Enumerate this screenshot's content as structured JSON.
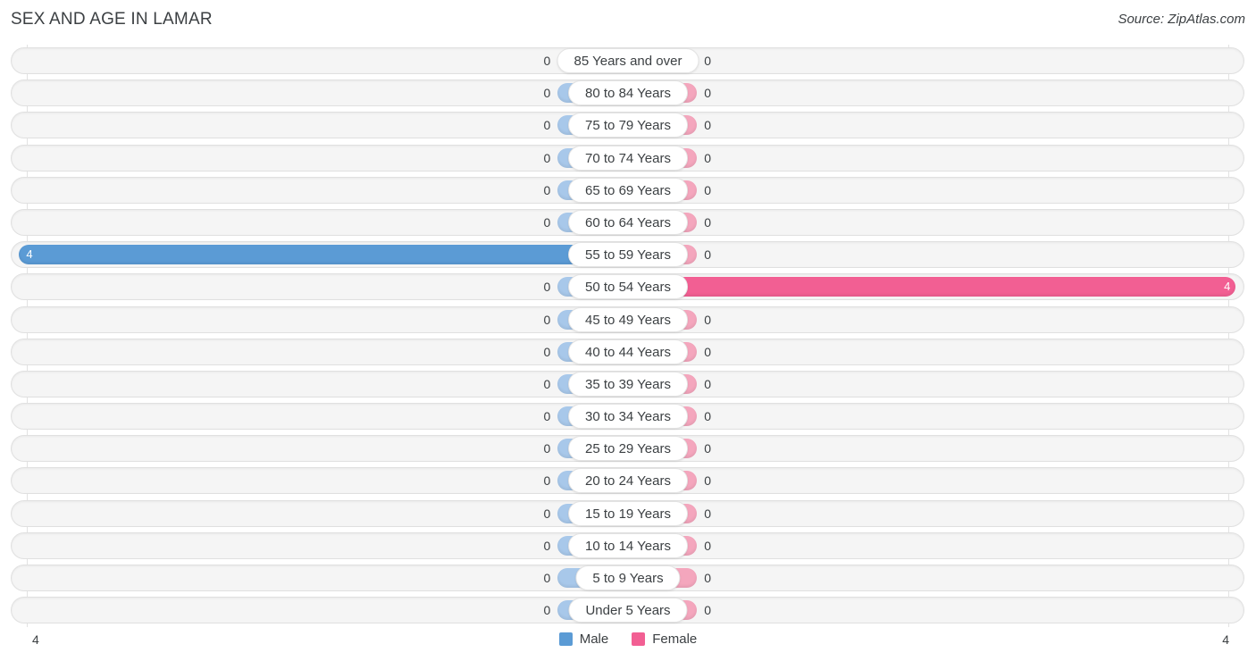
{
  "header": {
    "title": "SEX AND AGE IN LAMAR",
    "source": "Source: ZipAtlas.com"
  },
  "legend": {
    "male_label": "Male",
    "female_label": "Female",
    "male_color": "#5b9bd5",
    "female_color": "#f25f93"
  },
  "axis": {
    "min_label": "4",
    "max_label": "4"
  },
  "colors": {
    "male_bar": "#5b9bd5",
    "female_bar": "#f25f93",
    "male_bar_zero": "#a8c8ea",
    "female_bar_zero": "#f4a6bd",
    "track": "#f5f5f5",
    "gridline": "#e2e2e2"
  },
  "chart_data": {
    "type": "bar",
    "title": "SEX AND AGE IN LAMAR",
    "subtitle": "",
    "xlabel": "",
    "ylabel": "",
    "orientation": "horizontal",
    "style": "diverging-population-pyramid",
    "legend_position": "bottom-center",
    "grid": true,
    "xlim": [
      4,
      4
    ],
    "categories": [
      "85 Years and over",
      "80 to 84 Years",
      "75 to 79 Years",
      "70 to 74 Years",
      "65 to 69 Years",
      "60 to 64 Years",
      "55 to 59 Years",
      "50 to 54 Years",
      "45 to 49 Years",
      "40 to 44 Years",
      "35 to 39 Years",
      "30 to 34 Years",
      "25 to 29 Years",
      "20 to 24 Years",
      "15 to 19 Years",
      "10 to 14 Years",
      "5 to 9 Years",
      "Under 5 Years"
    ],
    "series": [
      {
        "name": "Male",
        "color": "#5b9bd5",
        "values": [
          0,
          0,
          0,
          0,
          0,
          0,
          4,
          0,
          0,
          0,
          0,
          0,
          0,
          0,
          0,
          0,
          0,
          0
        ]
      },
      {
        "name": "Female",
        "color": "#f25f93",
        "values": [
          0,
          0,
          0,
          0,
          0,
          0,
          0,
          4,
          0,
          0,
          0,
          0,
          0,
          0,
          0,
          0,
          0,
          0
        ]
      }
    ]
  },
  "rows": [
    {
      "label": "85 Years and over",
      "male": "0",
      "female": "0",
      "male_val": 0,
      "female_val": 0
    },
    {
      "label": "80 to 84 Years",
      "male": "0",
      "female": "0",
      "male_val": 0,
      "female_val": 0
    },
    {
      "label": "75 to 79 Years",
      "male": "0",
      "female": "0",
      "male_val": 0,
      "female_val": 0
    },
    {
      "label": "70 to 74 Years",
      "male": "0",
      "female": "0",
      "male_val": 0,
      "female_val": 0
    },
    {
      "label": "65 to 69 Years",
      "male": "0",
      "female": "0",
      "male_val": 0,
      "female_val": 0
    },
    {
      "label": "60 to 64 Years",
      "male": "0",
      "female": "0",
      "male_val": 0,
      "female_val": 0
    },
    {
      "label": "55 to 59 Years",
      "male": "4",
      "female": "0",
      "male_val": 4,
      "female_val": 0
    },
    {
      "label": "50 to 54 Years",
      "male": "0",
      "female": "4",
      "male_val": 0,
      "female_val": 4
    },
    {
      "label": "45 to 49 Years",
      "male": "0",
      "female": "0",
      "male_val": 0,
      "female_val": 0
    },
    {
      "label": "40 to 44 Years",
      "male": "0",
      "female": "0",
      "male_val": 0,
      "female_val": 0
    },
    {
      "label": "35 to 39 Years",
      "male": "0",
      "female": "0",
      "male_val": 0,
      "female_val": 0
    },
    {
      "label": "30 to 34 Years",
      "male": "0",
      "female": "0",
      "male_val": 0,
      "female_val": 0
    },
    {
      "label": "25 to 29 Years",
      "male": "0",
      "female": "0",
      "male_val": 0,
      "female_val": 0
    },
    {
      "label": "20 to 24 Years",
      "male": "0",
      "female": "0",
      "male_val": 0,
      "female_val": 0
    },
    {
      "label": "15 to 19 Years",
      "male": "0",
      "female": "0",
      "male_val": 0,
      "female_val": 0
    },
    {
      "label": "10 to 14 Years",
      "male": "0",
      "female": "0",
      "male_val": 0,
      "female_val": 0
    },
    {
      "label": "5 to 9 Years",
      "male": "0",
      "female": "0",
      "male_val": 0,
      "female_val": 0
    },
    {
      "label": "Under 5 Years",
      "male": "0",
      "female": "0",
      "male_val": 0,
      "female_val": 0
    }
  ]
}
